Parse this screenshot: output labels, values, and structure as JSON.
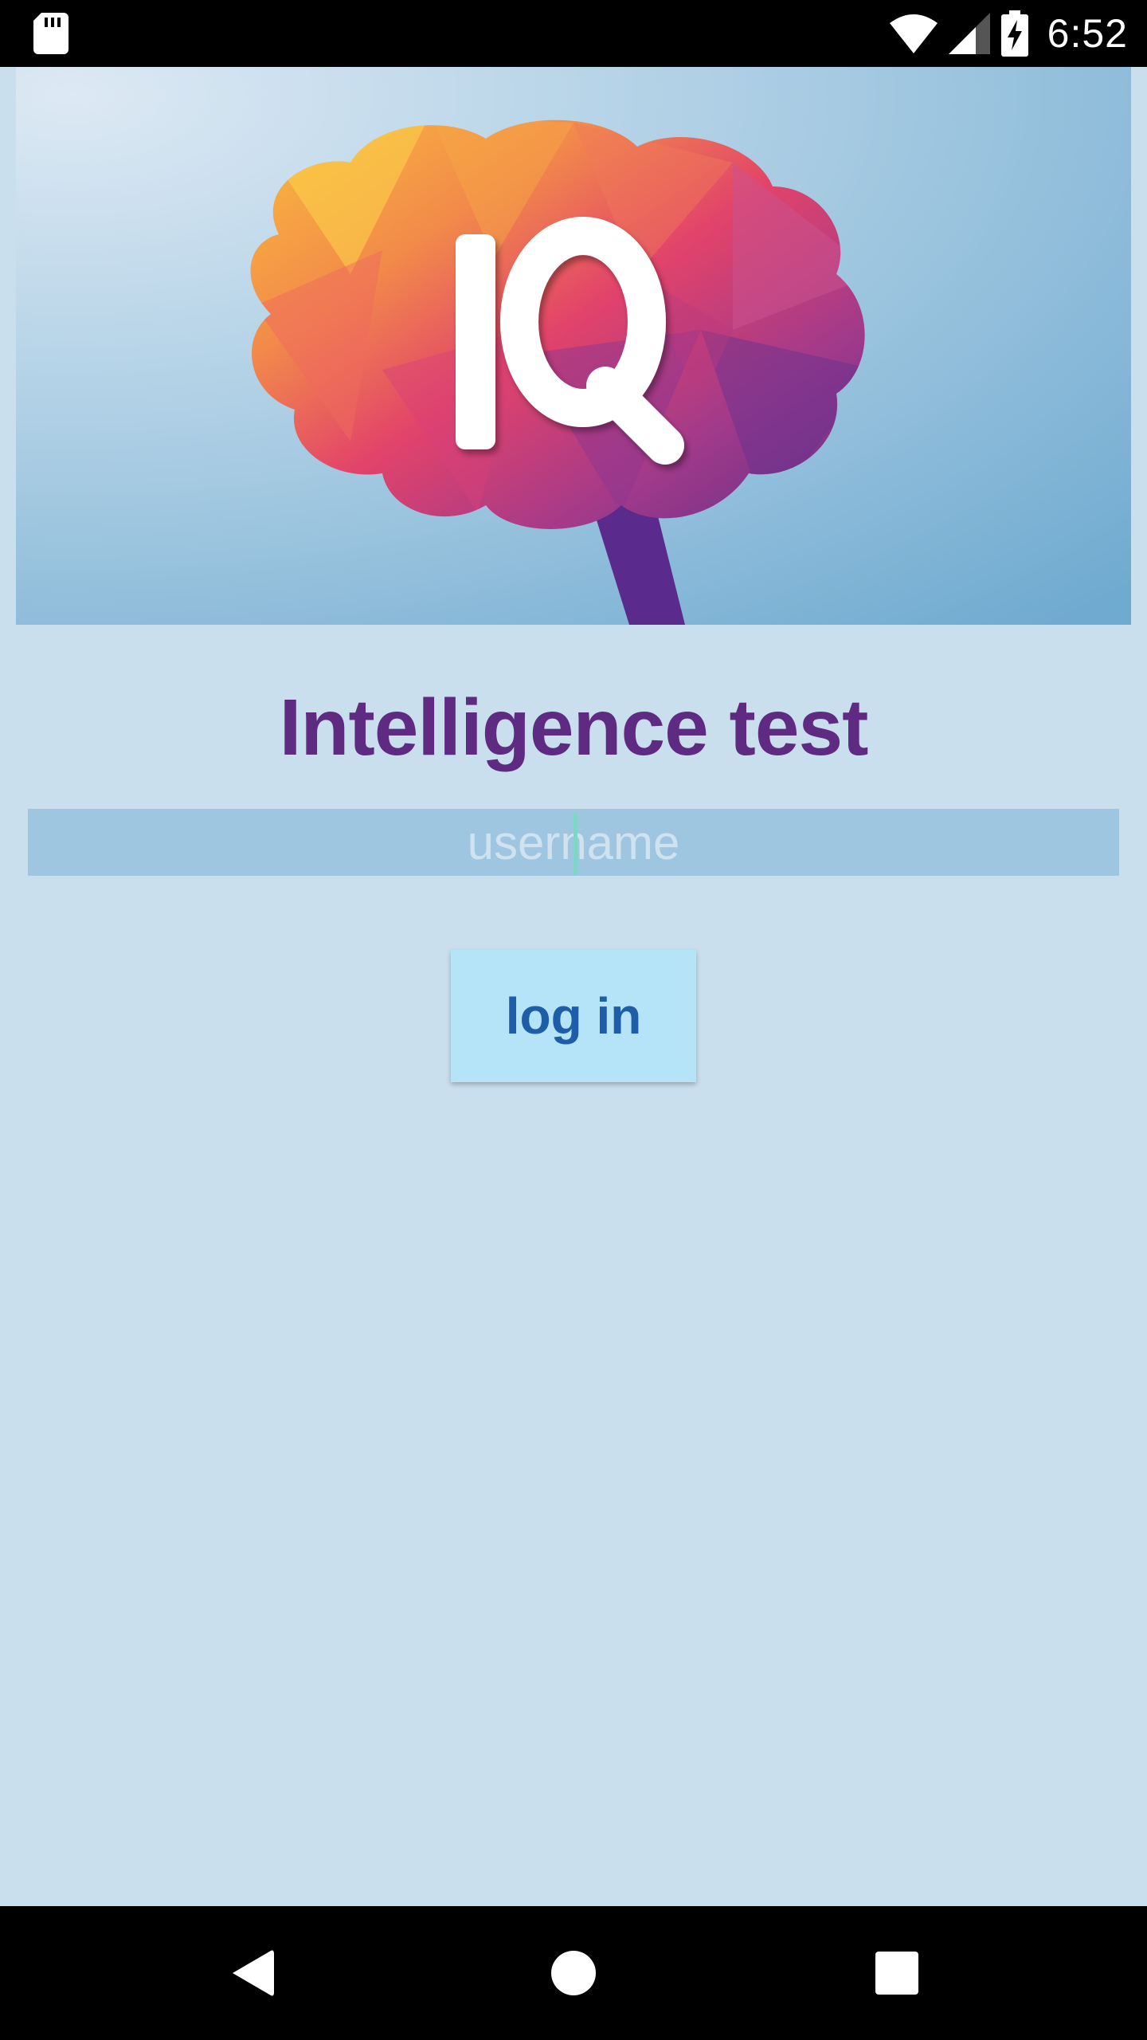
{
  "status_bar": {
    "time": "6:52",
    "icons": [
      "sd-card-icon",
      "wifi-icon",
      "signal-icon",
      "battery-charging-icon"
    ]
  },
  "banner": {
    "logo_text": "IQ",
    "icon": "brain-logo"
  },
  "title": "Intelligence test",
  "username_input": {
    "placeholder": "username",
    "value": ""
  },
  "login_button": {
    "label": "log in"
  },
  "nav_bar": {
    "icons": [
      "back-icon",
      "home-icon",
      "recents-icon"
    ]
  },
  "colors": {
    "background": "#cadfed",
    "title": "#5e2a82",
    "input_background": "#9fc6e0",
    "button_background": "#b5e3f8",
    "button_text": "#1e5ea8"
  }
}
